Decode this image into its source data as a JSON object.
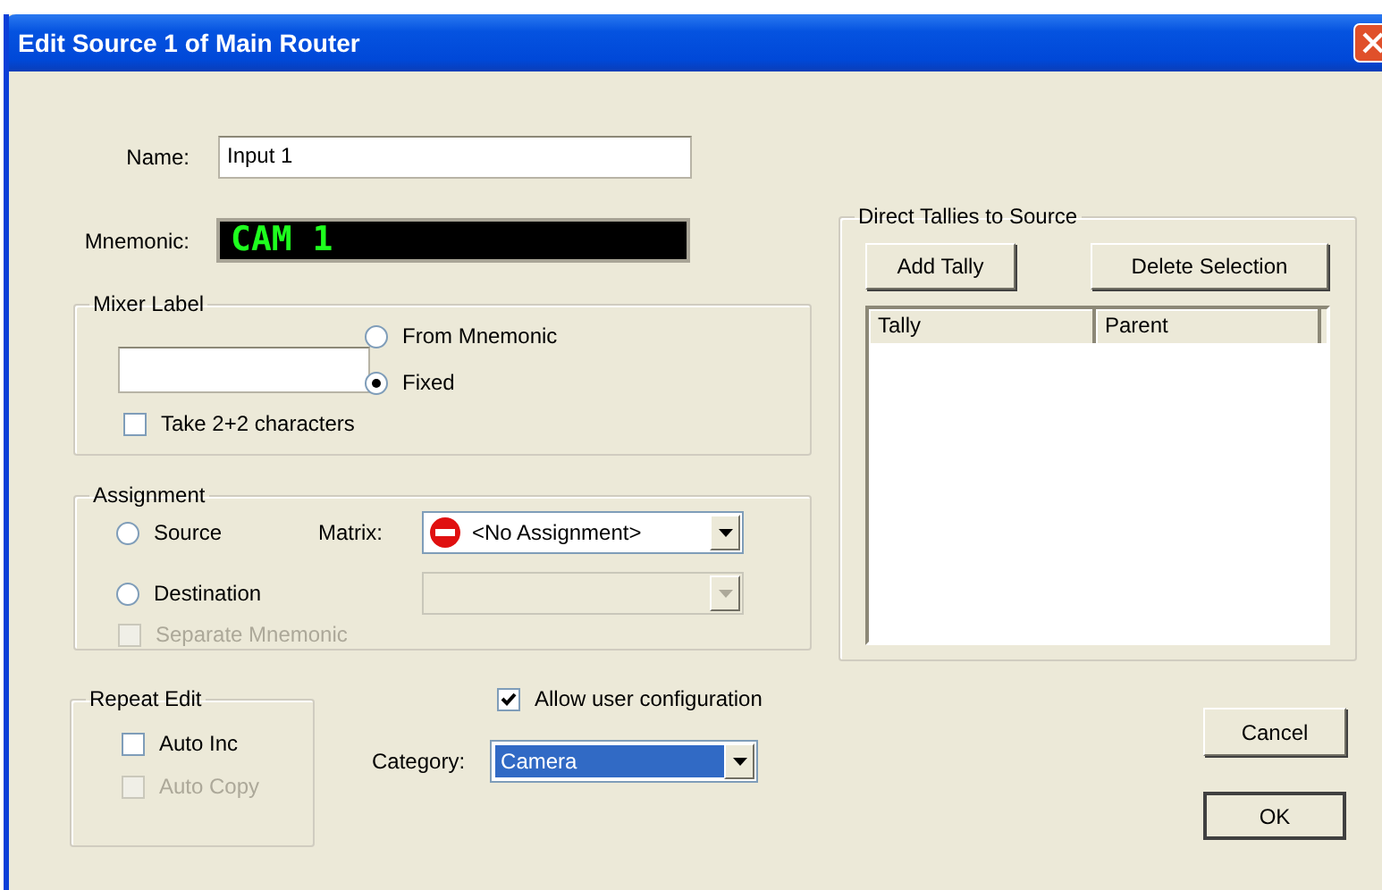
{
  "window": {
    "title": "Edit Source 1 of Main Router"
  },
  "name_field": {
    "label": "Name:",
    "value": "Input 1"
  },
  "mnemonic": {
    "label": "Mnemonic:",
    "value": "CAM 1"
  },
  "mixer_label": {
    "title": "Mixer Label",
    "options": [
      {
        "label": "From Mnemonic",
        "selected": false
      },
      {
        "label": "Fixed",
        "selected": true
      }
    ],
    "take_characters": {
      "label": "Take 2+2 characters",
      "checked": false
    }
  },
  "assignment": {
    "title": "Assignment",
    "options": [
      {
        "label": "Source",
        "selected": false
      },
      {
        "label": "Destination",
        "selected": false
      }
    ],
    "separate_mnemonic": {
      "label": "Separate Mnemonic",
      "checked": false,
      "disabled": true
    },
    "matrix": {
      "label": "Matrix:",
      "value": "<No Assignment>"
    },
    "second_dropdown": {
      "disabled": true
    }
  },
  "repeat_edit": {
    "title": "Repeat Edit",
    "checkboxes": [
      {
        "label": "Auto Inc",
        "checked": false,
        "disabled": false
      },
      {
        "label": "Auto Copy",
        "checked": false,
        "disabled": true
      }
    ]
  },
  "allow_user_configuration": {
    "label": "Allow user configuration",
    "checked": true
  },
  "category": {
    "label": "Category:",
    "value": "Camera",
    "highlighted": true
  },
  "direct_tallies": {
    "title": "Direct Tallies to Source",
    "buttons": [
      "Add Tally",
      "Delete Selection"
    ],
    "columns": [
      "Tally",
      "Parent"
    ]
  },
  "buttons": [
    {
      "label": "Cancel",
      "default": false
    },
    {
      "label": "OK",
      "default": true
    }
  ]
}
